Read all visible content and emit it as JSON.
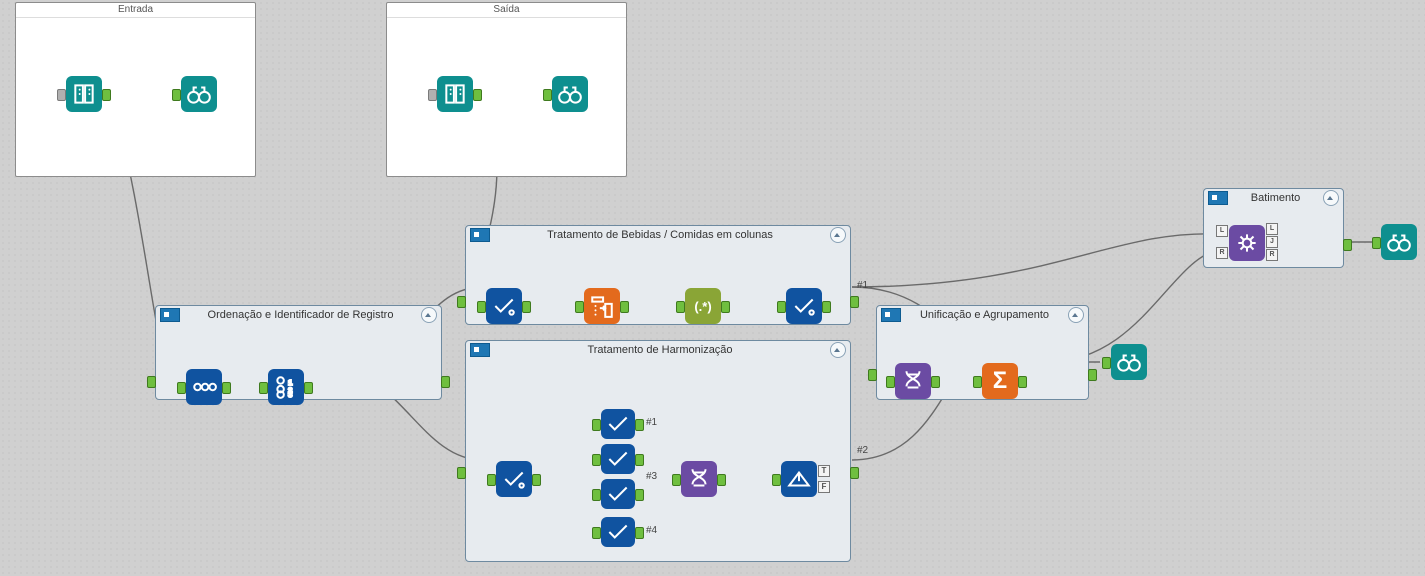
{
  "containers": {
    "entrada": {
      "title": "Entrada"
    },
    "saida": {
      "title": "Saída"
    },
    "ordenacao": {
      "title": "Ordenação e Identificador de Registro"
    },
    "bebidas": {
      "title": "Tratamento de Bebidas / Comidas em colunas"
    },
    "harmon": {
      "title": "Tratamento de Harmonização"
    },
    "unif": {
      "title": "Unificação e Agrupamento"
    },
    "bat": {
      "title": "Batimento"
    }
  },
  "labels": {
    "n1": "#1",
    "n2": "#2",
    "n3": "#3",
    "n4": "#4",
    "h1": "#1",
    "sum": "Σ",
    "regex": "(.*)",
    "T": "T",
    "F": "F",
    "L": "L",
    "J": "J",
    "R": "R"
  }
}
